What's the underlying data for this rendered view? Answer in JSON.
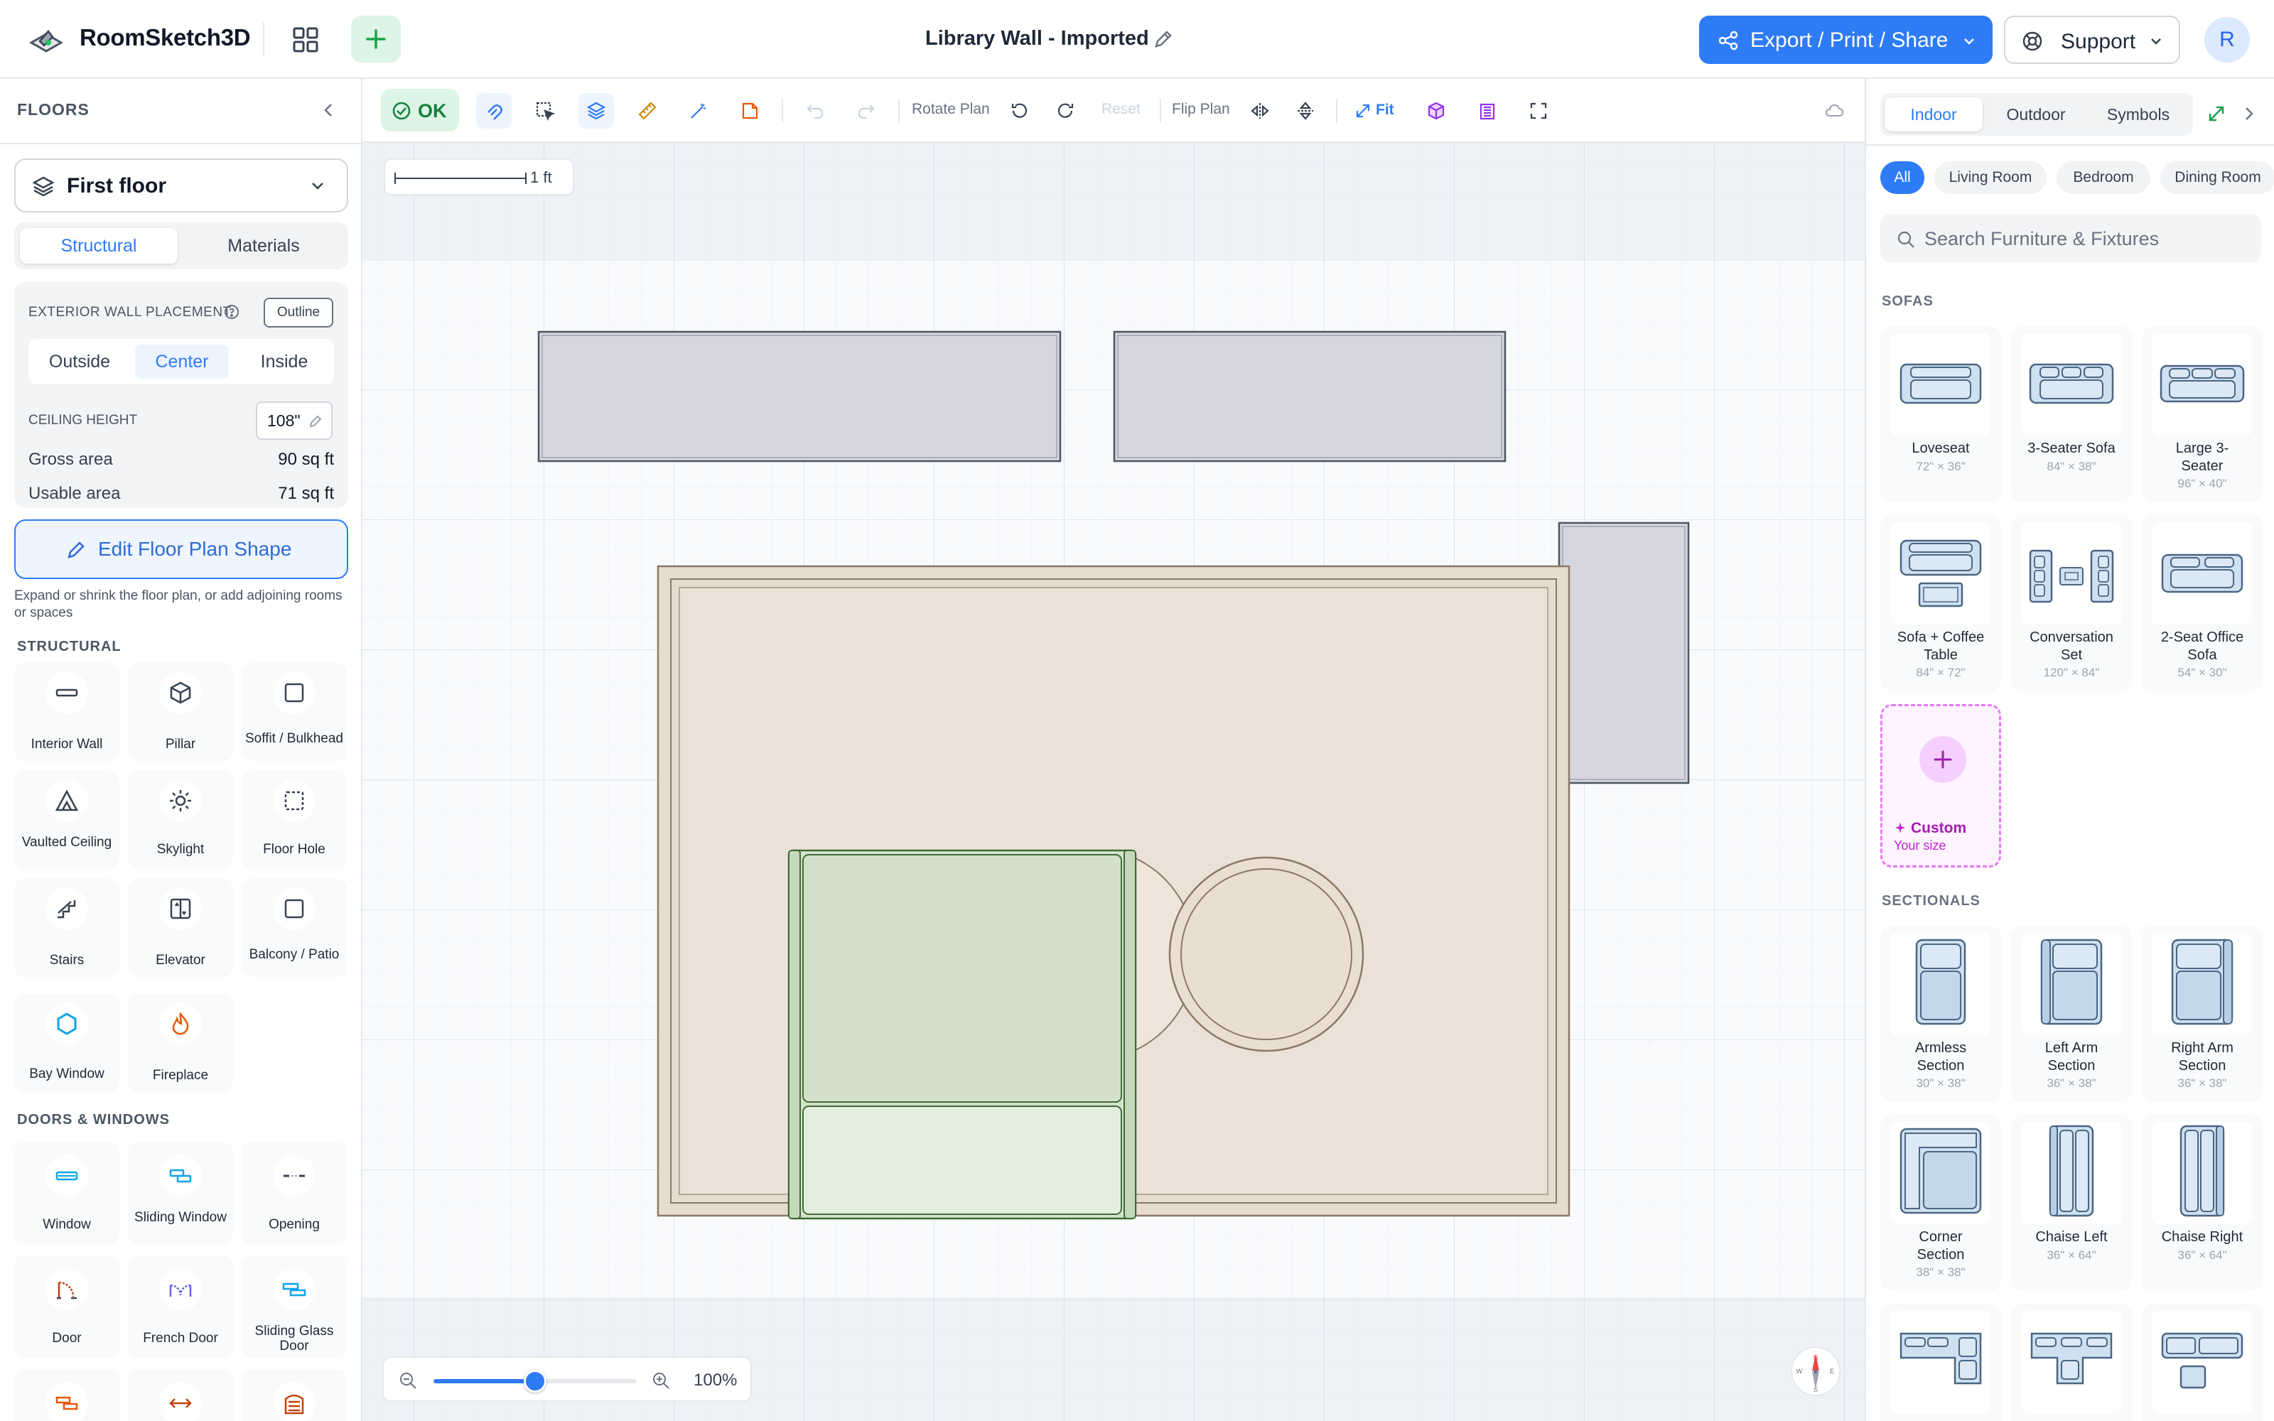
{
  "app": {
    "name": "RoomSketch3D"
  },
  "header": {
    "doc_title": "Library Wall - Imported",
    "export_label": "Export / Print / Share",
    "support_label": "Support",
    "avatar_initial": "R"
  },
  "left": {
    "floors_title": "FLOORS",
    "floor_name": "First floor",
    "tabs": [
      "Structural",
      "Materials"
    ],
    "wall_placement_label": "EXTERIOR WALL PLACEMENT",
    "outline_label": "Outline",
    "placement_options": [
      "Outside",
      "Center",
      "Inside"
    ],
    "ceiling_label": "CEILING HEIGHT",
    "ceiling_value": "108\"",
    "gross_label": "Gross area",
    "gross_value": "90 sq ft",
    "usable_label": "Usable area",
    "usable_value": "71 sq ft",
    "edit_button": "Edit Floor Plan Shape",
    "edit_help": "Expand or shrink the floor plan, or add adjoining rooms or spaces",
    "structural_title": "STRUCTURAL",
    "structural_items": [
      {
        "label": "Interior Wall",
        "icon": "wall-icon"
      },
      {
        "label": "Pillar",
        "icon": "cube-icon"
      },
      {
        "label": "Soffit / Bulkhead",
        "icon": "square-icon"
      },
      {
        "label": "Vaulted Ceiling",
        "icon": "tent-icon"
      },
      {
        "label": "Skylight",
        "icon": "sun-icon"
      },
      {
        "label": "Floor Hole",
        "icon": "dashed-square-icon"
      },
      {
        "label": "Stairs",
        "icon": "stairs-icon"
      },
      {
        "label": "Elevator",
        "icon": "elevator-icon"
      },
      {
        "label": "Balcony / Patio",
        "icon": "balcony-icon"
      },
      {
        "label": "Bay Window",
        "icon": "hexagon-icon"
      },
      {
        "label": "Fireplace",
        "icon": "flame-icon"
      }
    ],
    "doors_title": "DOORS & WINDOWS",
    "door_items": [
      {
        "label": "Window",
        "icon": "window-icon"
      },
      {
        "label": "Sliding Window",
        "icon": "sliding-window-icon"
      },
      {
        "label": "Opening",
        "icon": "opening-icon"
      },
      {
        "label": "Door",
        "icon": "door-icon"
      },
      {
        "label": "French Door",
        "icon": "french-door-icon"
      },
      {
        "label": "Sliding Glass Door",
        "icon": "sliding-door-icon"
      }
    ]
  },
  "toolbar": {
    "ok_label": "OK",
    "rotate_label": "Rotate Plan",
    "reset_label": "Reset",
    "flip_label": "Flip Plan",
    "fit_label": "Fit"
  },
  "canvas": {
    "scale_label": "1 ft",
    "zoom_label": "100%",
    "zoom_level": 0.5,
    "compass": [
      "N",
      "W",
      "E",
      "S"
    ]
  },
  "right": {
    "tabs": [
      "Indoor",
      "Outdoor",
      "Symbols"
    ],
    "chips": [
      "All",
      "Living Room",
      "Bedroom",
      "Dining Room"
    ],
    "search_placeholder": "Search Furniture & Fixtures",
    "sofas_title": "SOFAS",
    "sofas": [
      {
        "label": "Loveseat",
        "size": "72\" × 36\""
      },
      {
        "label": "3-Seater Sofa",
        "size": "84\" × 38\""
      },
      {
        "label": "Large 3-Seater",
        "size": "96\" × 40\""
      },
      {
        "label": "Sofa + Coffee Table",
        "size": "84\" × 72\""
      },
      {
        "label": "Conversation Set",
        "size": "120\" × 84\""
      },
      {
        "label": "2-Seat Office Sofa",
        "size": "54\" × 30\""
      }
    ],
    "custom_label": "Custom",
    "custom_sub": "Your size",
    "sectionals_title": "SECTIONALS",
    "sectionals": [
      {
        "label": "Armless Section",
        "size": "30\" × 38\""
      },
      {
        "label": "Left Arm Section",
        "size": "36\" × 38\""
      },
      {
        "label": "Right Arm Section",
        "size": "36\" × 38\""
      },
      {
        "label": "Corner Section",
        "size": "38\" × 38\""
      },
      {
        "label": "Chaise Left",
        "size": "36\" × 64\""
      },
      {
        "label": "Chaise Right",
        "size": "36\" × 64\""
      }
    ]
  },
  "colors": {
    "accent": "#2e7bf6",
    "ok_bg": "#dcf5e6",
    "rug": "#e9dfd4",
    "sofa": "#d5e3cc",
    "shelf": "#d6d6e0"
  }
}
